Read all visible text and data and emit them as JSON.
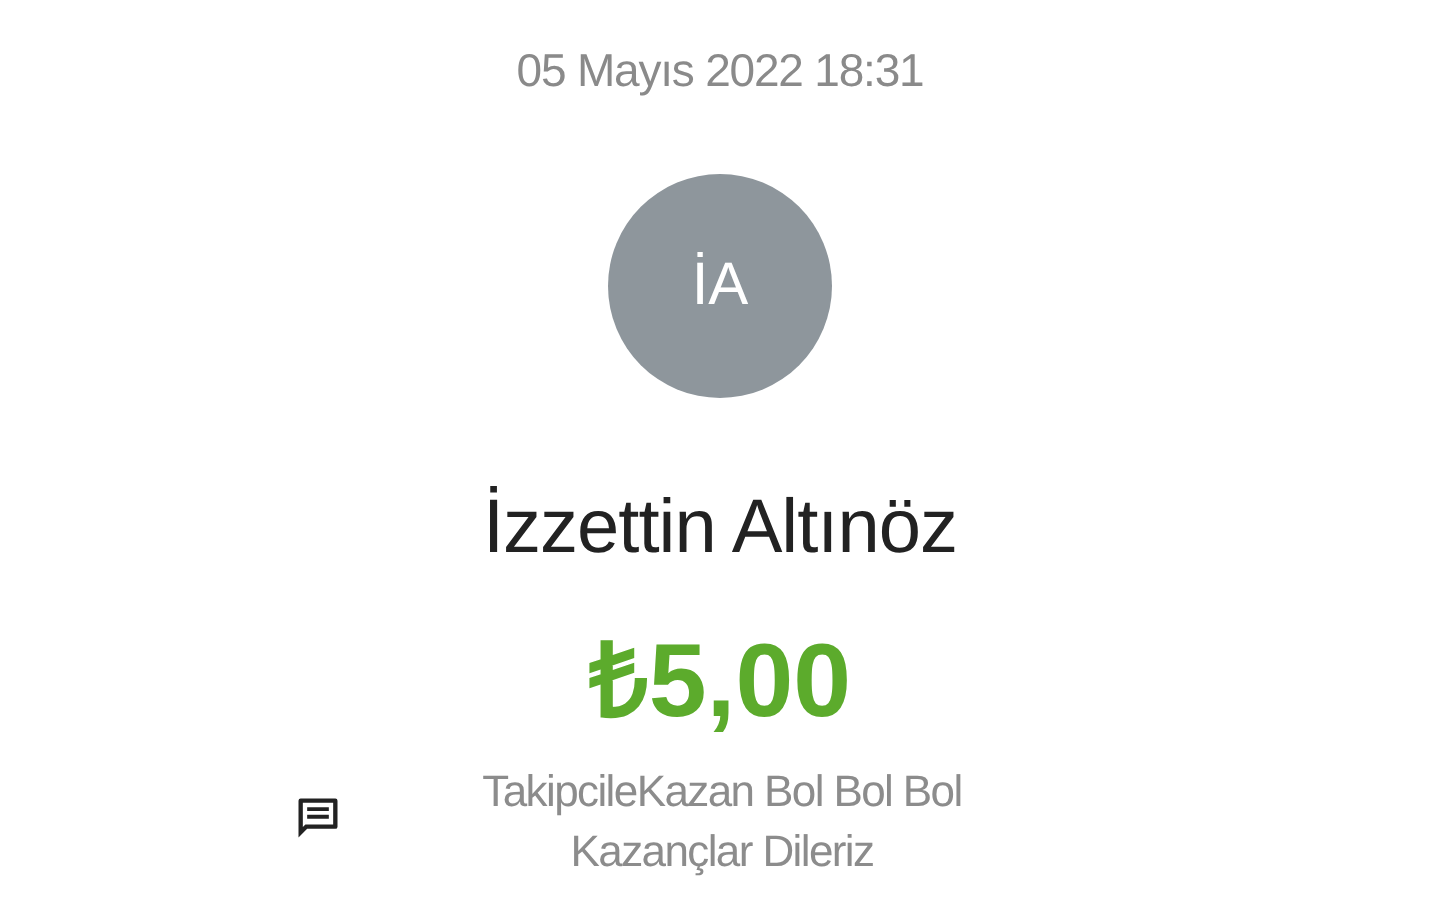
{
  "date": "05 Mayıs 2022 18:31",
  "avatar": {
    "initials": "İA"
  },
  "name": "İzzettin Altınöz",
  "amount": "₺5,00",
  "message": "TakipcileKazan Bol Bol Bol Kazançlar Dileriz"
}
